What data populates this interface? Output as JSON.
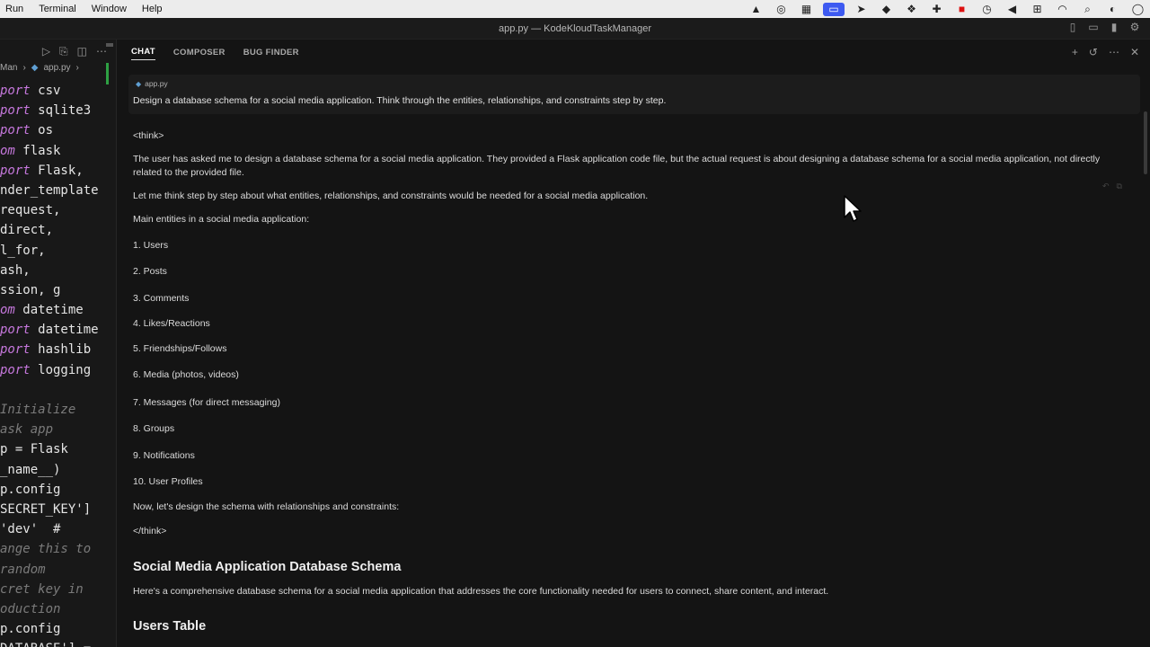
{
  "menubar": {
    "items": [
      "Run",
      "Terminal",
      "Window",
      "Help"
    ]
  },
  "window": {
    "title": "app.py — KodeKloudTaskManager"
  },
  "editor": {
    "breadcrumb_project": "Man",
    "breadcrumb_file": "app.py",
    "lines": [
      {
        "k": "port",
        "r": " csv"
      },
      {
        "k": "port",
        "r": " sqlite3"
      },
      {
        "k": "port",
        "r": " os"
      },
      {
        "k": "om",
        "r": " flask"
      },
      {
        "k": "port",
        "r": " Flask,"
      },
      {
        "k": "",
        "r": "nder_template"
      },
      {
        "k": "",
        "r": "request,"
      },
      {
        "k": "",
        "r": "direct,"
      },
      {
        "k": "",
        "r": "l_for,"
      },
      {
        "k": "",
        "r": "ash,"
      },
      {
        "k": "",
        "r": "ssion, g"
      },
      {
        "k": "om",
        "r": " datetime"
      },
      {
        "k": "port",
        "r": " datetime"
      },
      {
        "k": "port",
        "r": " hashlib"
      },
      {
        "k": "port",
        "r": " logging"
      },
      {
        "k": "",
        "r": ""
      },
      {
        "k": "",
        "r": "Initialize",
        "c": true
      },
      {
        "k": "",
        "r": "ask app",
        "c": true
      },
      {
        "k": "",
        "r": "p = Flask"
      },
      {
        "k": "",
        "r": "_name__)"
      },
      {
        "k": "",
        "r": "p.config"
      },
      {
        "k": "",
        "r": "SECRET_KEY']"
      },
      {
        "k": "",
        "r": "'dev'  #"
      },
      {
        "k": "",
        "r": "ange this to",
        "c": true
      },
      {
        "k": "",
        "r": "random",
        "c": true
      },
      {
        "k": "",
        "r": "cret key in",
        "c": true
      },
      {
        "k": "",
        "r": "oduction",
        "c": true
      },
      {
        "k": "",
        "r": "p.config"
      },
      {
        "k": "",
        "r": "DATABASE'] ="
      }
    ]
  },
  "chat": {
    "tabs": [
      "CHAT",
      "COMPOSER",
      "BUG FINDER"
    ],
    "context_file": "app.py",
    "query": "Design a database schema for a social media application. Think through the entities, relationships, and constraints step by step.",
    "think_open": "<think>",
    "p1": "The user has asked me to design a database schema for a social media application. They provided a Flask application code file, but the actual request is about designing a database schema for a social media application, not directly related to the provided file.",
    "p2": "Let me think step by step about what entities, relationships, and constraints would be needed for a social media application.",
    "p3": "Main entities in a social media application:",
    "entities": [
      "1. Users",
      "2. Posts",
      "3. Comments",
      "4. Likes/Reactions",
      "5. Friendships/Follows",
      "6. Media (photos, videos)",
      "7. Messages (for direct messaging)",
      "8. Groups",
      "9. Notifications",
      "10. User Profiles"
    ],
    "p4": "Now, let's design the schema with relationships and constraints:",
    "think_close": "</think>",
    "heading": "Social Media Application Database Schema",
    "intro": "Here's a comprehensive database schema for a social media application that addresses the core functionality needed for users to connect, share content, and interact.",
    "subheading": "Users Table"
  }
}
